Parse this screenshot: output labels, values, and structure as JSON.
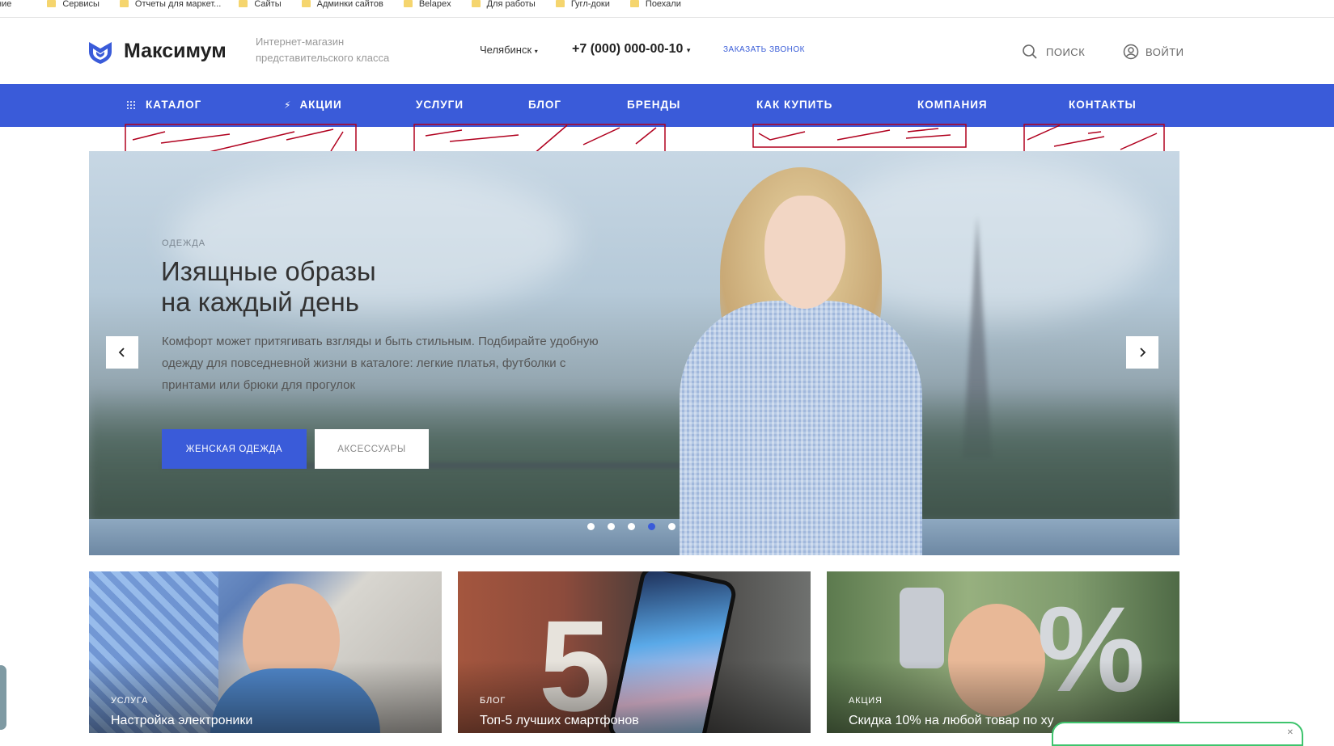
{
  "bookmarks": [
    {
      "label": "ние",
      "folder": false
    },
    {
      "label": "Сервисы",
      "folder": true
    },
    {
      "label": "Отчеты для маркет...",
      "folder": true
    },
    {
      "label": "Сайты",
      "folder": true
    },
    {
      "label": "Админки сайтов",
      "folder": true
    },
    {
      "label": "Belapex",
      "folder": true
    },
    {
      "label": "Для работы",
      "folder": true
    },
    {
      "label": "Гугл-доки",
      "folder": true
    },
    {
      "label": "Поехали",
      "folder": true
    }
  ],
  "header": {
    "brand": "Максимум",
    "tagline": "Интернет-магазин представительского класса",
    "city": "Челябинск",
    "phone": "+7 (000) 000-00-10",
    "callback": "ЗАКАЗАТЬ ЗВОНОК",
    "search_label": "ПОИСК",
    "login_label": "ВОЙТИ"
  },
  "nav": {
    "items": [
      "КАТАЛОГ",
      "АКЦИИ",
      "УСЛУГИ",
      "БЛОГ",
      "БРЕНДЫ",
      "КАК КУПИТЬ",
      "КОМПАНИЯ",
      "КОНТАКТЫ"
    ]
  },
  "banner": {
    "kicker": "ОДЕЖДА",
    "headline_line1": "Изящные образы",
    "headline_line2": "на каждый день",
    "lead": "Комфорт может притягивать взгляды и быть стильным. Подбирайте удобную одежду для повседневной жизни в каталоге: легкие платья, футболки с принтами или брюки для прогулок",
    "primary_button": "ЖЕНСКАЯ ОДЕЖДА",
    "secondary_button": "АКСЕССУАРЫ",
    "slides_total": 5,
    "active_slide": 4
  },
  "cards": [
    {
      "tag": "УСЛУГА",
      "title": "Настройка электроники"
    },
    {
      "tag": "БЛОГ",
      "title": "Топ-5 лучших смартфонов"
    },
    {
      "tag": "АКЦИЯ",
      "title": "Скидка 10% на любой товар по ху"
    }
  ],
  "colors": {
    "accent": "#3a5bd9",
    "scribble": "#b0001e"
  }
}
